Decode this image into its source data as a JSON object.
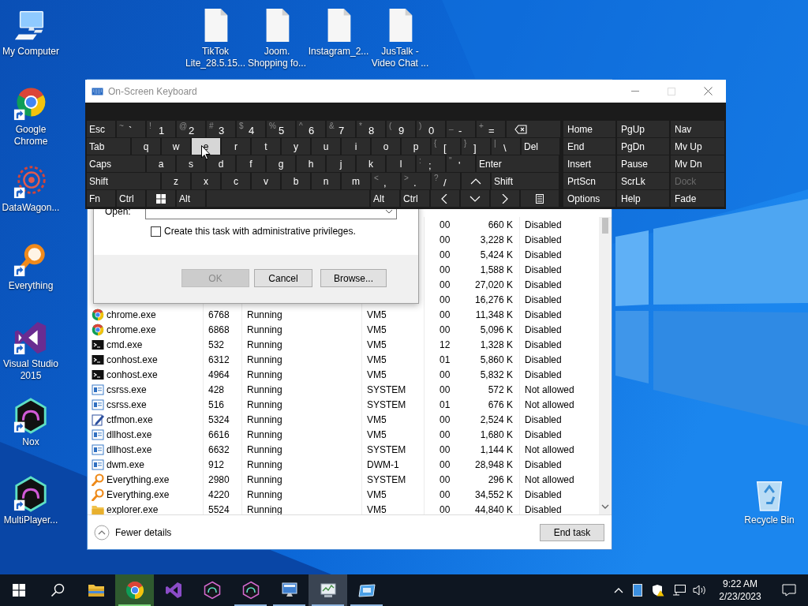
{
  "left_icons": [
    {
      "kind": "computer",
      "label": "My Computer",
      "shortcut": false
    },
    {
      "kind": "chrome",
      "label": "Google Chrome",
      "shortcut": true
    },
    {
      "kind": "datawagon",
      "label": "DataWagon...",
      "shortcut": true
    },
    {
      "kind": "everything",
      "label": "Everything",
      "shortcut": true
    },
    {
      "kind": "visual-studio",
      "label": "Visual Studio 2015",
      "shortcut": true
    },
    {
      "kind": "nox",
      "label": "Nox",
      "shortcut": true
    },
    {
      "kind": "nox",
      "label": "MultiPlayer...",
      "shortcut": true
    }
  ],
  "top_icons": [
    {
      "label": "TikTok Lite_28.5.15..."
    },
    {
      "label": "Joom. Shopping fo..."
    },
    {
      "label": "Instagram_2..."
    },
    {
      "label": "JusTalk - Video Chat ..."
    }
  ],
  "recycle_bin": {
    "label": "Recycle Bin"
  },
  "task_manager": {
    "rows": [
      {
        "session": "00",
        "memory": "660 K",
        "uac": "Disabled"
      },
      {
        "session": "00",
        "memory": "3,228 K",
        "uac": "Disabled"
      },
      {
        "session": "00",
        "memory": "5,424 K",
        "uac": "Disabled"
      },
      {
        "session": "00",
        "memory": "1,588 K",
        "uac": "Disabled"
      },
      {
        "session": "00",
        "memory": "27,020 K",
        "uac": "Disabled"
      },
      {
        "session": "00",
        "memory": "16,276 K",
        "uac": "Disabled"
      },
      {
        "kind": "browser",
        "name": "chrome.exe",
        "pid": "6768",
        "status": "Running",
        "user": "VM5",
        "session": "00",
        "memory": "11,348 K",
        "uac": "Disabled"
      },
      {
        "kind": "browser",
        "name": "chrome.exe",
        "pid": "6868",
        "status": "Running",
        "user": "VM5",
        "session": "00",
        "memory": "5,096 K",
        "uac": "Disabled"
      },
      {
        "kind": "console",
        "name": "cmd.exe",
        "pid": "532",
        "status": "Running",
        "user": "VM5",
        "session": "12",
        "memory": "1,328 K",
        "uac": "Disabled"
      },
      {
        "kind": "console",
        "name": "conhost.exe",
        "pid": "6312",
        "status": "Running",
        "user": "VM5",
        "session": "01",
        "memory": "5,860 K",
        "uac": "Disabled"
      },
      {
        "kind": "console",
        "name": "conhost.exe",
        "pid": "4964",
        "status": "Running",
        "user": "VM5",
        "session": "00",
        "memory": "5,832 K",
        "uac": "Disabled"
      },
      {
        "kind": "service",
        "name": "csrss.exe",
        "pid": "428",
        "status": "Running",
        "user": "SYSTEM",
        "session": "00",
        "memory": "572 K",
        "uac": "Not allowed"
      },
      {
        "kind": "service",
        "name": "csrss.exe",
        "pid": "516",
        "status": "Running",
        "user": "SYSTEM",
        "session": "01",
        "memory": "676 K",
        "uac": "Not allowed"
      },
      {
        "kind": "pen",
        "name": "ctfmon.exe",
        "pid": "5324",
        "status": "Running",
        "user": "VM5",
        "session": "00",
        "memory": "2,524 K",
        "uac": "Disabled"
      },
      {
        "kind": "service",
        "name": "dllhost.exe",
        "pid": "6616",
        "status": "Running",
        "user": "VM5",
        "session": "00",
        "memory": "1,680 K",
        "uac": "Disabled"
      },
      {
        "kind": "service",
        "name": "dllhost.exe",
        "pid": "6632",
        "status": "Running",
        "user": "SYSTEM",
        "session": "00",
        "memory": "1,144 K",
        "uac": "Not allowed"
      },
      {
        "kind": "service",
        "name": "dwm.exe",
        "pid": "912",
        "status": "Running",
        "user": "DWM-1",
        "session": "00",
        "memory": "28,948 K",
        "uac": "Disabled"
      },
      {
        "kind": "search",
        "name": "Everything.exe",
        "pid": "2980",
        "status": "Running",
        "user": "SYSTEM",
        "session": "00",
        "memory": "296 K",
        "uac": "Not allowed"
      },
      {
        "kind": "search",
        "name": "Everything.exe",
        "pid": "4220",
        "status": "Running",
        "user": "VM5",
        "session": "00",
        "memory": "34,552 K",
        "uac": "Disabled"
      },
      {
        "kind": "folder",
        "name": "explorer.exe",
        "pid": "5524",
        "status": "Running",
        "user": "VM5",
        "session": "00",
        "memory": "44,840 K",
        "uac": "Disabled"
      }
    ],
    "details_toggle": "Fewer details",
    "end_task": "End task"
  },
  "run_dialog": {
    "open_label": "Open:",
    "admin_checkbox": {
      "label": "Create this task with administrative privileges.",
      "checked": false
    },
    "buttons": [
      {
        "label": "OK",
        "disabled": true
      },
      {
        "label": "Cancel",
        "disabled": false
      },
      {
        "label": "Browse...",
        "disabled": false
      }
    ]
  },
  "keyboard": {
    "title": "On-Screen Keyboard",
    "rows": [
      [
        {
          "kind": "text",
          "label": "Esc",
          "highlighted": false
        },
        {
          "kind": "dual",
          "shift": "~",
          "label": "`",
          "highlighted": false
        },
        {
          "kind": "dual",
          "shift": "!",
          "label": "1",
          "highlighted": false
        },
        {
          "kind": "dual",
          "shift": "@",
          "label": "2",
          "highlighted": false
        },
        {
          "kind": "dual",
          "shift": "#",
          "label": "3",
          "highlighted": false
        },
        {
          "kind": "dual",
          "shift": "$",
          "label": "4",
          "highlighted": false
        },
        {
          "kind": "dual",
          "shift": "%",
          "label": "5",
          "highlighted": false
        },
        {
          "kind": "dual",
          "shift": "^",
          "label": "6",
          "highlighted": false
        },
        {
          "kind": "dual",
          "shift": "&",
          "label": "7",
          "highlighted": false
        },
        {
          "kind": "dual",
          "shift": "*",
          "label": "8",
          "highlighted": false
        },
        {
          "kind": "dual",
          "shift": "(",
          "label": "9",
          "highlighted": false
        },
        {
          "kind": "dual",
          "shift": ")",
          "label": "0",
          "highlighted": false
        },
        {
          "kind": "dual",
          "shift": "_",
          "label": "-",
          "highlighted": false
        },
        {
          "kind": "dual",
          "shift": "+",
          "label": "=",
          "highlighted": false
        },
        {
          "kind": "backspace",
          "highlighted": false
        }
      ],
      [
        {
          "kind": "text",
          "label": "Tab",
          "highlighted": false
        },
        {
          "kind": "letter",
          "label": "q",
          "highlighted": false
        },
        {
          "kind": "letter",
          "label": "w",
          "highlighted": false
        },
        {
          "kind": "letter",
          "label": "e",
          "highlighted": true
        },
        {
          "kind": "letter",
          "label": "r",
          "highlighted": false
        },
        {
          "kind": "letter",
          "label": "t",
          "highlighted": false
        },
        {
          "kind": "letter",
          "label": "y",
          "highlighted": false
        },
        {
          "kind": "letter",
          "label": "u",
          "highlighted": false
        },
        {
          "kind": "letter",
          "label": "i",
          "highlighted": false
        },
        {
          "kind": "letter",
          "label": "o",
          "highlighted": false
        },
        {
          "kind": "letter",
          "label": "p",
          "highlighted": false
        },
        {
          "kind": "dual",
          "shift": "{",
          "label": "[",
          "highlighted": false
        },
        {
          "kind": "dual",
          "shift": "}",
          "label": "]",
          "highlighted": false
        },
        {
          "kind": "dual",
          "shift": "|",
          "label": "\\",
          "highlighted": false
        },
        {
          "kind": "text",
          "label": "Del",
          "highlighted": false
        }
      ],
      [
        {
          "kind": "text",
          "label": "Caps",
          "highlighted": false
        },
        {
          "kind": "letter",
          "label": "a",
          "highlighted": false
        },
        {
          "kind": "letter",
          "label": "s",
          "highlighted": false
        },
        {
          "kind": "letter",
          "label": "d",
          "highlighted": false
        },
        {
          "kind": "letter",
          "label": "f",
          "highlighted": false
        },
        {
          "kind": "letter",
          "label": "g",
          "highlighted": false
        },
        {
          "kind": "letter",
          "label": "h",
          "highlighted": false
        },
        {
          "kind": "letter",
          "label": "j",
          "highlighted": false
        },
        {
          "kind": "letter",
          "label": "k",
          "highlighted": false
        },
        {
          "kind": "letter",
          "label": "l",
          "highlighted": false
        },
        {
          "kind": "dual",
          "shift": ":",
          "label": ";",
          "highlighted": false
        },
        {
          "kind": "dual",
          "shift": "\"",
          "label": "'",
          "highlighted": false
        },
        {
          "kind": "text",
          "label": "Enter",
          "highlighted": false
        }
      ],
      [
        {
          "kind": "text",
          "label": "Shift",
          "highlighted": false
        },
        {
          "kind": "letter",
          "label": "z",
          "highlighted": false
        },
        {
          "kind": "letter",
          "label": "x",
          "highlighted": false
        },
        {
          "kind": "letter",
          "label": "c",
          "highlighted": false
        },
        {
          "kind": "letter",
          "label": "v",
          "highlighted": false
        },
        {
          "kind": "letter",
          "label": "b",
          "highlighted": false
        },
        {
          "kind": "letter",
          "label": "n",
          "highlighted": false
        },
        {
          "kind": "letter",
          "label": "m",
          "highlighted": false
        },
        {
          "kind": "dual",
          "shift": "<",
          "label": ",",
          "highlighted": false
        },
        {
          "kind": "dual",
          "shift": ">",
          "label": ".",
          "highlighted": false
        },
        {
          "kind": "dual",
          "shift": "?",
          "label": "/",
          "highlighted": false
        },
        {
          "kind": "up",
          "highlighted": false
        },
        {
          "kind": "text",
          "label": "Shift",
          "highlighted": false
        }
      ],
      [
        {
          "kind": "text",
          "label": "Fn",
          "highlighted": false
        },
        {
          "kind": "text",
          "label": "Ctrl",
          "highlighted": false
        },
        {
          "kind": "windows",
          "highlighted": false
        },
        {
          "kind": "text",
          "label": "Alt",
          "highlighted": false
        },
        {
          "kind": "space",
          "highlighted": false
        },
        {
          "kind": "text",
          "label": "Alt",
          "highlighted": false
        },
        {
          "kind": "text",
          "label": "Ctrl",
          "highlighted": false
        },
        {
          "kind": "left",
          "highlighted": false
        },
        {
          "kind": "down",
          "highlighted": false
        },
        {
          "kind": "right",
          "highlighted": false
        },
        {
          "kind": "menu",
          "highlighted": false
        }
      ]
    ],
    "side_keys": [
      [
        {
          "label": "Home",
          "disabled": false
        },
        {
          "label": "PgUp",
          "disabled": false
        },
        {
          "label": "Nav",
          "disabled": false
        }
      ],
      [
        {
          "label": "End",
          "disabled": false
        },
        {
          "label": "PgDn",
          "disabled": false
        },
        {
          "label": "Mv Up",
          "disabled": false
        }
      ],
      [
        {
          "label": "Insert",
          "disabled": false
        },
        {
          "label": "Pause",
          "disabled": false
        },
        {
          "label": "Mv Dn",
          "disabled": false
        }
      ],
      [
        {
          "label": "PrtScn",
          "disabled": false
        },
        {
          "label": "ScrLk",
          "disabled": false
        },
        {
          "label": "Dock",
          "disabled": true
        }
      ],
      [
        {
          "label": "Options",
          "disabled": false
        },
        {
          "label": "Help",
          "disabled": false
        },
        {
          "label": "Fade",
          "disabled": false
        }
      ]
    ]
  },
  "taskbar": {
    "apps": [
      {
        "kind": "folder",
        "running": false,
        "active": false,
        "flagged": false
      },
      {
        "kind": "chrome",
        "running": true,
        "active": false,
        "flagged": true
      },
      {
        "kind": "visual-studio",
        "running": false,
        "active": false,
        "flagged": false
      },
      {
        "kind": "nox",
        "running": false,
        "active": false,
        "flagged": false
      },
      {
        "kind": "nox",
        "running": true,
        "active": false,
        "flagged": false
      },
      {
        "kind": "monitor",
        "running": true,
        "active": false,
        "flagged": false
      },
      {
        "kind": "task-manager",
        "running": true,
        "active": true,
        "flagged": false
      },
      {
        "kind": "window",
        "running": true,
        "active": false,
        "flagged": false
      }
    ],
    "time": "9:22 AM",
    "date": "2/23/2023"
  }
}
